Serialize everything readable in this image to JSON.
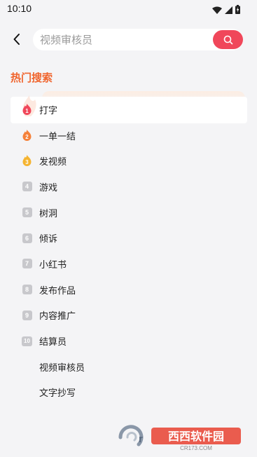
{
  "status_bar": {
    "time": "10:10",
    "icons": [
      "wifi-icon",
      "cell-signal-icon",
      "battery-charging-icon"
    ]
  },
  "header": {
    "back_icon": "chevron-left-icon",
    "search": {
      "value": "",
      "placeholder": "视频审核员"
    },
    "search_button_icon": "search-icon"
  },
  "section": {
    "title": "热门搜索"
  },
  "colors": {
    "accent": "#f0475a",
    "section_title": "#f0652e",
    "rank_1": "#f0475a",
    "rank_2": "#f5813a",
    "rank_3": "#f5b431",
    "rank_other": "#c8c8cc"
  },
  "hot_list": [
    {
      "rank": "1",
      "label": "打字"
    },
    {
      "rank": "2",
      "label": "一单一结"
    },
    {
      "rank": "3",
      "label": "发视频"
    },
    {
      "rank": "4",
      "label": "游戏"
    },
    {
      "rank": "5",
      "label": "树洞"
    },
    {
      "rank": "6",
      "label": "倾诉"
    },
    {
      "rank": "7",
      "label": "小红书"
    },
    {
      "rank": "8",
      "label": "发布作品"
    },
    {
      "rank": "9",
      "label": "内容推广"
    },
    {
      "rank": "10",
      "label": "结算员"
    },
    {
      "rank": "",
      "label": "视频审核员"
    },
    {
      "rank": "",
      "label": "文字抄写"
    }
  ],
  "watermark": {
    "logo_text": "西西软件园",
    "sub_text": "CR173.COM"
  }
}
